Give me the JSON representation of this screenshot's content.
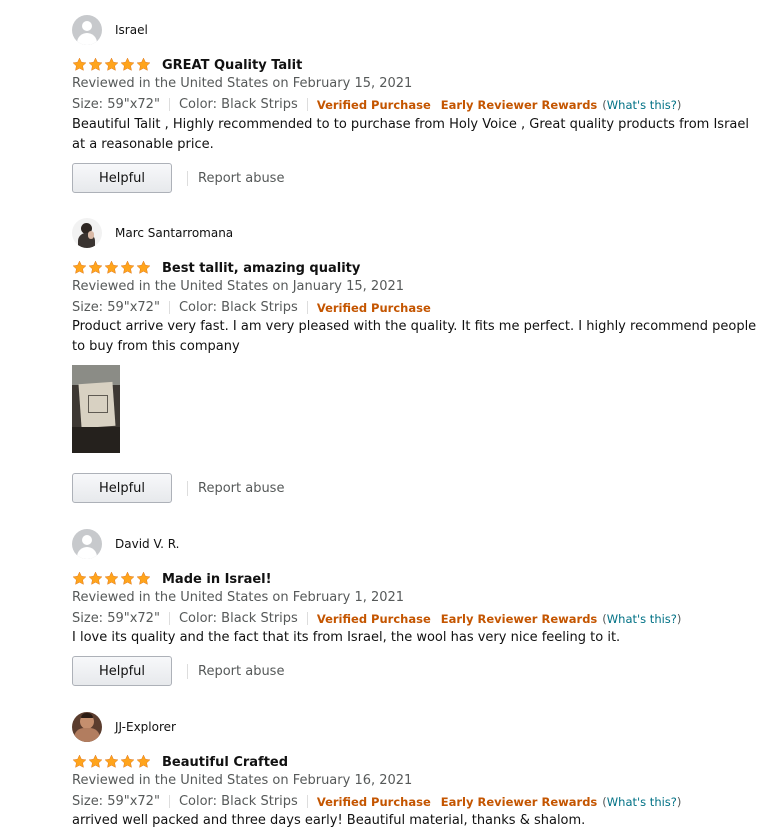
{
  "colors": {
    "star": "#ffa41c",
    "verified": "#c45500",
    "link": "#007185",
    "muted": "#565959"
  },
  "labels": {
    "helpful": "Helpful",
    "report": "Report abuse",
    "verified": "Verified Purchase",
    "early": "Early Reviewer Rewards",
    "whats_this": "What's this?",
    "paren_open": "(",
    "paren_close": ")"
  },
  "reviews": [
    {
      "name": "Israel",
      "avatar": "default-avatar",
      "rating": 5,
      "title": "GREAT Quality Talit",
      "date": "Reviewed in the United States on February 15, 2021",
      "size": "Size: 59\"x72\"",
      "color": "Color: Black Strips",
      "verified": true,
      "early_reviewer": true,
      "text": "Beautiful Talit , Highly recommended to to purchase from Holy Voice , Great quality products from Israel at a reasonable price."
    },
    {
      "name": "Marc Santarromana",
      "avatar": "profile-photo",
      "rating": 5,
      "title": "Best tallit, amazing quality",
      "date": "Reviewed in the United States on January 15, 2021",
      "size": "Size: 59\"x72\"",
      "color": "Color: Black Strips",
      "verified": true,
      "early_reviewer": false,
      "text": "Product arrive very fast. I am very pleased with the quality. It fits me perfect. I highly recommend people to buy from this company",
      "has_image": true
    },
    {
      "name": "David V. R.",
      "avatar": "default-avatar",
      "rating": 5,
      "title": "Made in Israel!",
      "date": "Reviewed in the United States on February 1, 2021",
      "size": "Size: 59\"x72\"",
      "color": "Color: Black Strips",
      "verified": true,
      "early_reviewer": true,
      "text": "I love its quality and the fact that its from Israel, the wool has very nice feeling to it."
    },
    {
      "name": "JJ-Explorer",
      "avatar": "profile-photo",
      "rating": 5,
      "title": "Beautiful Crafted",
      "date": "Reviewed in the United States on February 16, 2021",
      "size": "Size: 59\"x72\"",
      "color": "Color: Black Strips",
      "verified": true,
      "early_reviewer": true,
      "text": "arrived well packed and three days early! Beautiful material, thanks & shalom."
    }
  ]
}
